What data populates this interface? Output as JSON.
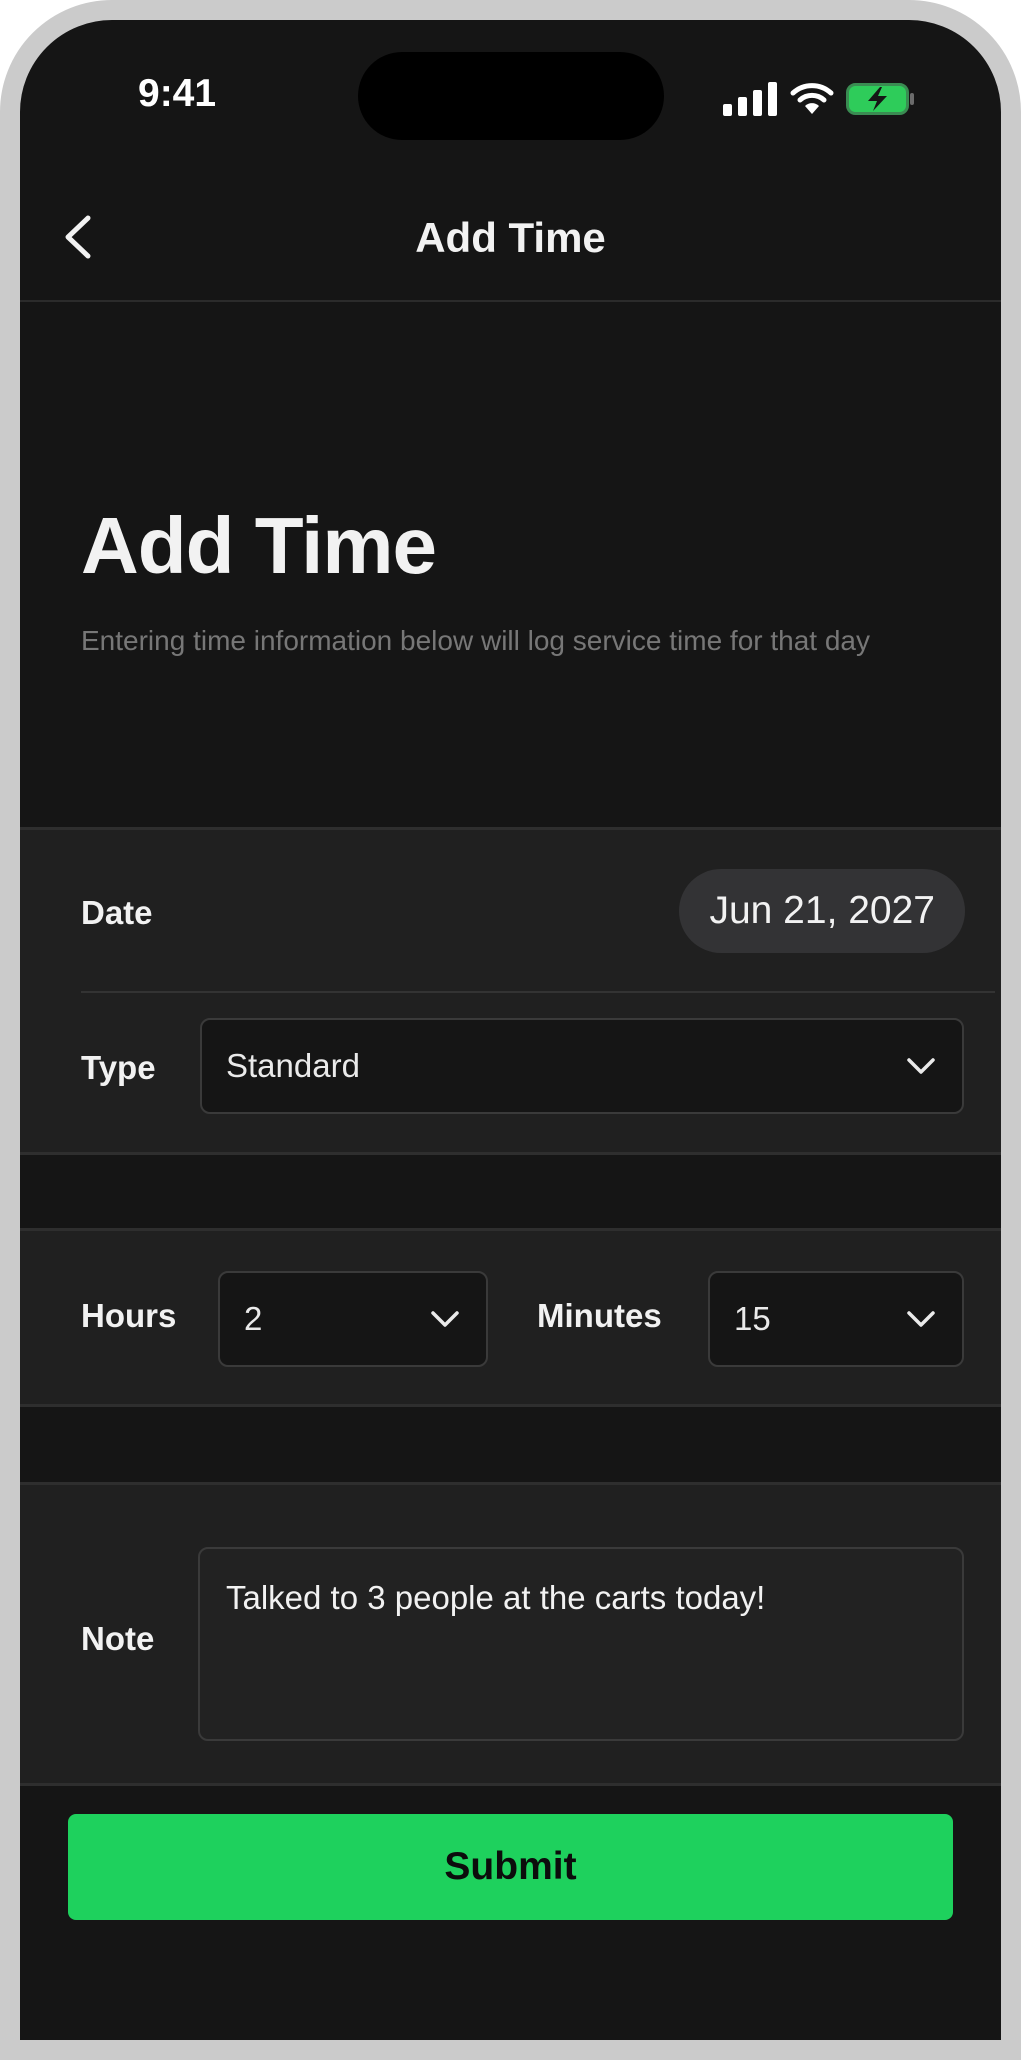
{
  "status_bar": {
    "time": "9:41",
    "signal_icon": "cellular-signal-icon",
    "wifi_icon": "wifi-icon",
    "battery_icon": "battery-charging-icon",
    "battery_color": "#2ecc5a"
  },
  "nav": {
    "title": "Add Time",
    "back_icon": "chevron-left-icon"
  },
  "hero": {
    "title": "Add Time",
    "subtitle": "Entering time information below will log service time for that day"
  },
  "form": {
    "date": {
      "label": "Date",
      "value": "Jun 21, 2027"
    },
    "type": {
      "label": "Type",
      "value": "Standard"
    },
    "hours": {
      "label": "Hours",
      "value": "2"
    },
    "minutes": {
      "label": "Minutes",
      "value": "15"
    },
    "note": {
      "label": "Note",
      "value": "Talked to 3 people at the carts today!"
    }
  },
  "submit": {
    "label": "Submit",
    "color": "#1ed15d"
  }
}
